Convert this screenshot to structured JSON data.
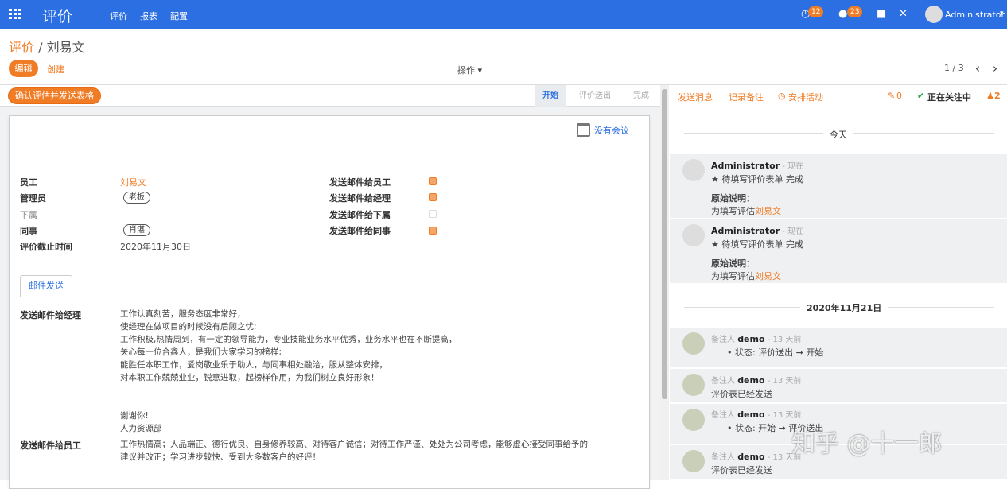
{
  "topbar": {
    "app_name": "评价",
    "menu": [
      "评价",
      "报表",
      "配置"
    ],
    "activity_count": "12",
    "message_count": "23",
    "user": "Administrator"
  },
  "breadcrumb": {
    "parent": "评价",
    "sep": "/",
    "current": "刘易文"
  },
  "toolbar": {
    "edit": "编辑",
    "create": "创建",
    "action": "操作 ▾",
    "pager": "1 / 3"
  },
  "statusbar": {
    "confirm": "确认评估并发送表格",
    "stages": [
      "开始",
      "评价送出",
      "完成"
    ]
  },
  "form": {
    "meeting": "没有会议",
    "left_labels": [
      "员工",
      "管理员",
      "下属",
      "同事",
      "评价截止时间"
    ],
    "employee": "刘易文",
    "manager_tag": "老板",
    "colleague_tag": "肖湛",
    "deadline": "2020年11月30日",
    "right_labels": [
      "发送邮件给员工",
      "发送邮件给经理",
      "发送邮件给下属",
      "发送邮件给同事"
    ],
    "checks": [
      true,
      true,
      false,
      true
    ],
    "tab": "邮件发送",
    "mail_manager_label": "发送邮件给经理",
    "mail_manager_text": [
      "工作认真刻苦，服务态度非常好，",
      "使经理在做项目的时候没有后顾之忧;",
      "工作积极,热情周到，有一定的领导能力，专业技能业务水平优秀，业务水平也在不断提高，",
      "关心每一位合鑫人，是我们大家学习的榜样;",
      "能胜任本职工作，爱岗敬业乐于助人，与同事相处融洽，服从整体安排，",
      "对本职工作兢兢业业，锐意进取，起榜样作用，为我们树立良好形象！",
      "",
      "",
      "谢谢你!",
      "人力资源部"
    ],
    "mail_employee_label": "发送邮件给员工",
    "mail_employee_text": [
      "工作热情高；人品端正、德行优良、自身修养较高、对待客户诚信；对待工作严谨、处处为公司考虑，能够虚心接受同事给予的",
      "建议并改正；学习进步较快、受到大多数客户的好评！"
    ]
  },
  "chatter": {
    "send": "发送消息",
    "log": "记录备注",
    "activity": "安排活动",
    "attach": "0",
    "following": "正在关注中",
    "followers": "2",
    "today": "今天",
    "date2": "2020年11月21日",
    "messages": [
      {
        "author": "Administrator",
        "meta": " - 现在",
        "line1": "★ 待填写评价表单 完成",
        "line2": "原始说明：",
        "line3a": "为填写评估",
        "line3b": "刘易文"
      },
      {
        "author": "Administrator",
        "meta": " - 现在",
        "line1": "★ 待填写评价表单 完成",
        "line2": "原始说明：",
        "line3a": "为填写评估",
        "line3b": "刘易文"
      },
      {
        "pre": "备注人 ",
        "author": "demo",
        "meta": " - 13 天前",
        "line1": "• 状态: 评价送出 ➞ 开始"
      },
      {
        "pre": "备注人 ",
        "author": "demo",
        "meta": " - 13 天前",
        "line1": "评价表已经发送"
      },
      {
        "pre": "备注人 ",
        "author": "demo",
        "meta": " - 13 天前",
        "line1": "• 状态: 开始 ➞ 评价送出"
      },
      {
        "pre": "备注人 ",
        "author": "demo",
        "meta": " - 13 天前",
        "line1": "评价表已经发送"
      }
    ]
  },
  "watermark": "知乎 @十一郎"
}
